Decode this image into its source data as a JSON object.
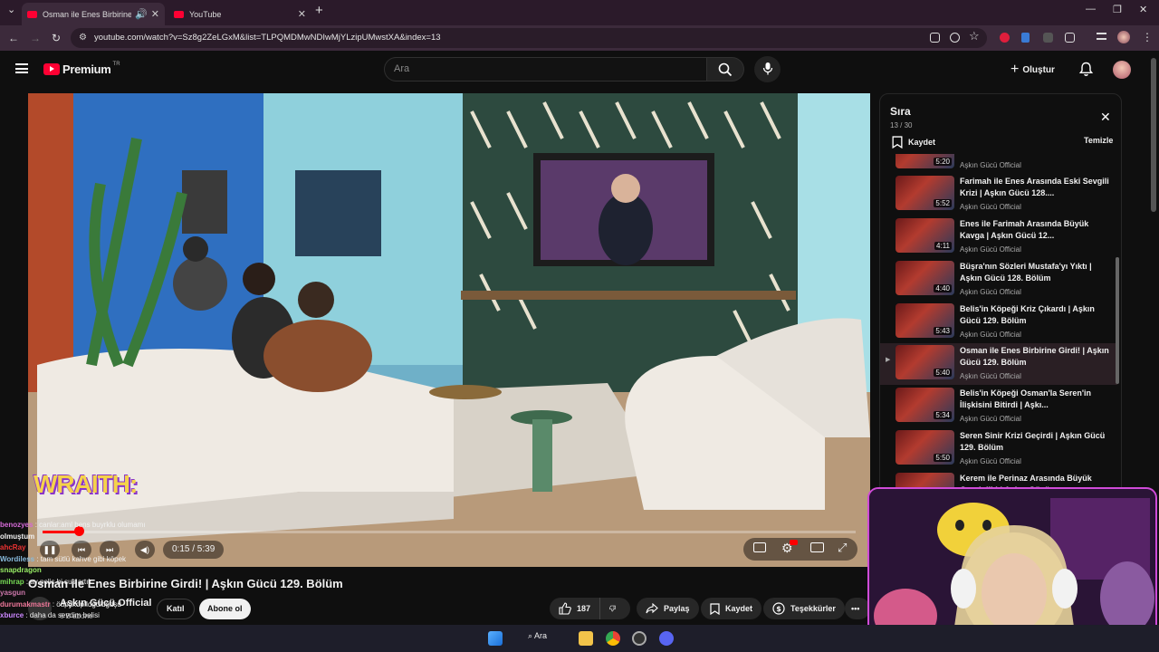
{
  "browser": {
    "tabs": [
      {
        "title": "Osman ile Enes Birbirine Gi",
        "active": true
      },
      {
        "title": "YouTube",
        "active": false
      }
    ],
    "url": "youtube.com/watch?v=Sz8g2ZeLGxM&list=TLPQMDMwNDIwMjYLzipUMwstXA&index=13"
  },
  "masthead": {
    "logo": "Premium",
    "logo_country": "TR",
    "search_placeholder": "Ara",
    "create_label": "Oluştur"
  },
  "player": {
    "overlay_text": "WRAITH:",
    "time": "0:15 / 5:39",
    "progress": 0.044
  },
  "video": {
    "title": "Osman ile Enes Birbirine Girdi! | Aşkın Gücü 129. Bölüm",
    "channel": "Aşkın Gücü Official",
    "subscribers": "6 B abone",
    "join_label": "Katıl",
    "subscribe_label": "Abone ol",
    "likes": "187",
    "share_label": "Paylaş",
    "save_label": "Kaydet",
    "thanks_label": "Teşekkürler"
  },
  "playlist": {
    "title": "Sıra",
    "count": "13 / 30",
    "save_label": "Kaydet",
    "clear_label": "Temizle",
    "items": [
      {
        "title": "",
        "duration": "5:20",
        "channel": "Aşkın Gücü Official"
      },
      {
        "title": "Farimah ile Enes Arasında Eski Sevgili Krizi | Aşkın Gücü 128....",
        "duration": "5:52",
        "channel": "Aşkın Gücü Official"
      },
      {
        "title": "Enes ile Farimah Arasında Büyük Kavga | Aşkın Gücü 12...",
        "duration": "4:11",
        "channel": "Aşkın Gücü Official"
      },
      {
        "title": "Büşra'nın Sözleri Mustafa'yı Yıktı | Aşkın Gücü 128. Bölüm",
        "duration": "4:40",
        "channel": "Aşkın Gücü Official"
      },
      {
        "title": "Belis'in Köpeği Kriz Çıkardı | Aşkın Gücü 129. Bölüm",
        "duration": "5:43",
        "channel": "Aşkın Gücü Official"
      },
      {
        "title": "Osman ile Enes Birbirine Girdi! | Aşkın Gücü 129. Bölüm",
        "duration": "5:40",
        "channel": "Aşkın Gücü Official",
        "active": true
      },
      {
        "title": "Belis'in Köpeği Osman'la Seren'in İlişkisini Bitirdi | Aşkı...",
        "duration": "5:34",
        "channel": "Aşkın Gücü Official"
      },
      {
        "title": "Seren Sinir Krizi Geçirdi | Aşkın Gücü 129. Bölüm",
        "duration": "5:50",
        "channel": "Aşkın Gücü Official"
      },
      {
        "title": "Kerem ile Perinaz Arasında Büyük Gerginlik! | Aşkın Gücü...",
        "duration": "",
        "channel": ""
      }
    ]
  },
  "chat": [
    {
      "user": "benozyes",
      "text": ": canlar:aml bens buyrklu olumamı"
    },
    {
      "user": "",
      "text": "olmuştum"
    },
    {
      "user": "ahcRay",
      "text": ""
    },
    {
      "user": "Wordiless",
      "text": ": tam sütlü kahve gibi köpek"
    },
    {
      "user": "snapdragon",
      "text": ""
    },
    {
      "user": "mihrap",
      "text": ": av pelis bi sus artık"
    },
    {
      "user": "yasgun",
      "text": ""
    },
    {
      "user": "durumakmastr",
      "text": ": ödpdkdpfldğdldğdşd"
    },
    {
      "user": "xburce",
      "text": ": daha da sevdim belisi"
    }
  ],
  "taskbar": {
    "search_label": "Ara"
  },
  "colors": {
    "accent": "#ff0033",
    "background": "#0f0f0f",
    "tab_bar": "#2b1a2a",
    "cam_border": "#d04bd8"
  }
}
